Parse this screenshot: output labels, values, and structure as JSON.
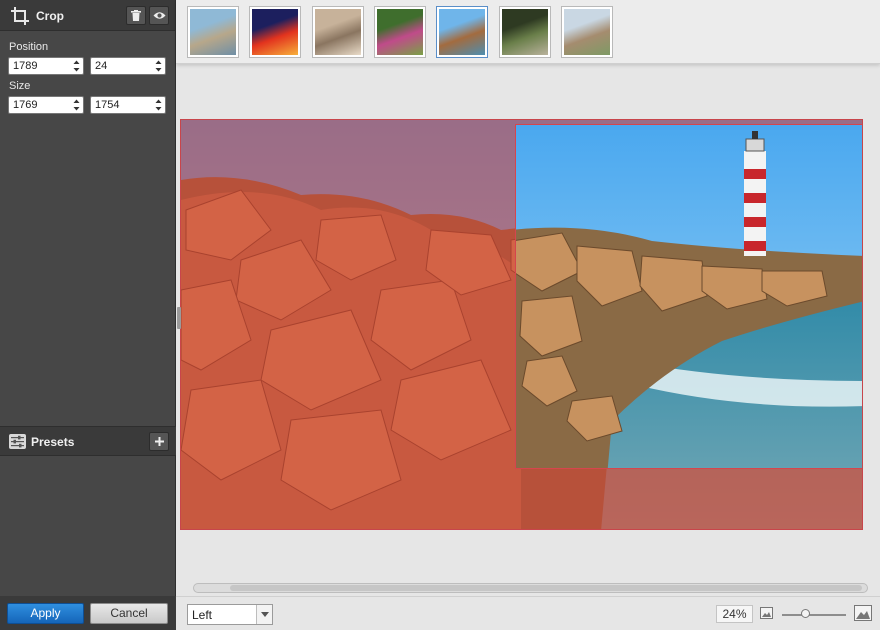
{
  "crop_panel": {
    "title": "Crop",
    "delete_icon": "trash-icon",
    "preview_icon": "eye-icon",
    "position_label": "Position",
    "position_x": "1789",
    "position_y": "24",
    "size_label": "Size",
    "size_w": "1769",
    "size_h": "1754"
  },
  "presets": {
    "title": "Presets",
    "add_icon": "plus-icon"
  },
  "actions": {
    "apply_label": "Apply",
    "cancel_label": "Cancel"
  },
  "thumbnails": [
    {
      "name": "thumb-tower",
      "colors": [
        "#8fb9d6",
        "#b7a78a",
        "#6f8fa6"
      ]
    },
    {
      "name": "thumb-red-tree",
      "colors": [
        "#1c1f5e",
        "#e2331e",
        "#f7b03a"
      ]
    },
    {
      "name": "thumb-plaza",
      "colors": [
        "#c7b29a",
        "#8a7560",
        "#e9dbc8"
      ]
    },
    {
      "name": "thumb-garden",
      "colors": [
        "#3f6e2d",
        "#c04b8a",
        "#7aa146"
      ]
    },
    {
      "name": "thumb-lighthouse",
      "colors": [
        "#6fb5ea",
        "#a36b3f",
        "#4e8eb0"
      ]
    },
    {
      "name": "thumb-fountain",
      "colors": [
        "#2e3a22",
        "#6a7f4a",
        "#b9b29c"
      ]
    },
    {
      "name": "thumb-coast",
      "colors": [
        "#c9d7e3",
        "#a58c6f",
        "#7e9a65"
      ]
    }
  ],
  "selected_thumbnail": 4,
  "alignment": {
    "value": "Left"
  },
  "zoom": {
    "value": "24%",
    "level": 0.38,
    "small_icon": "image-small-icon",
    "large_icon": "image-large-icon"
  },
  "colors": {
    "accent": "#1e74c8",
    "crop_border": "#d6454d",
    "overlay": "#dc3c32"
  }
}
